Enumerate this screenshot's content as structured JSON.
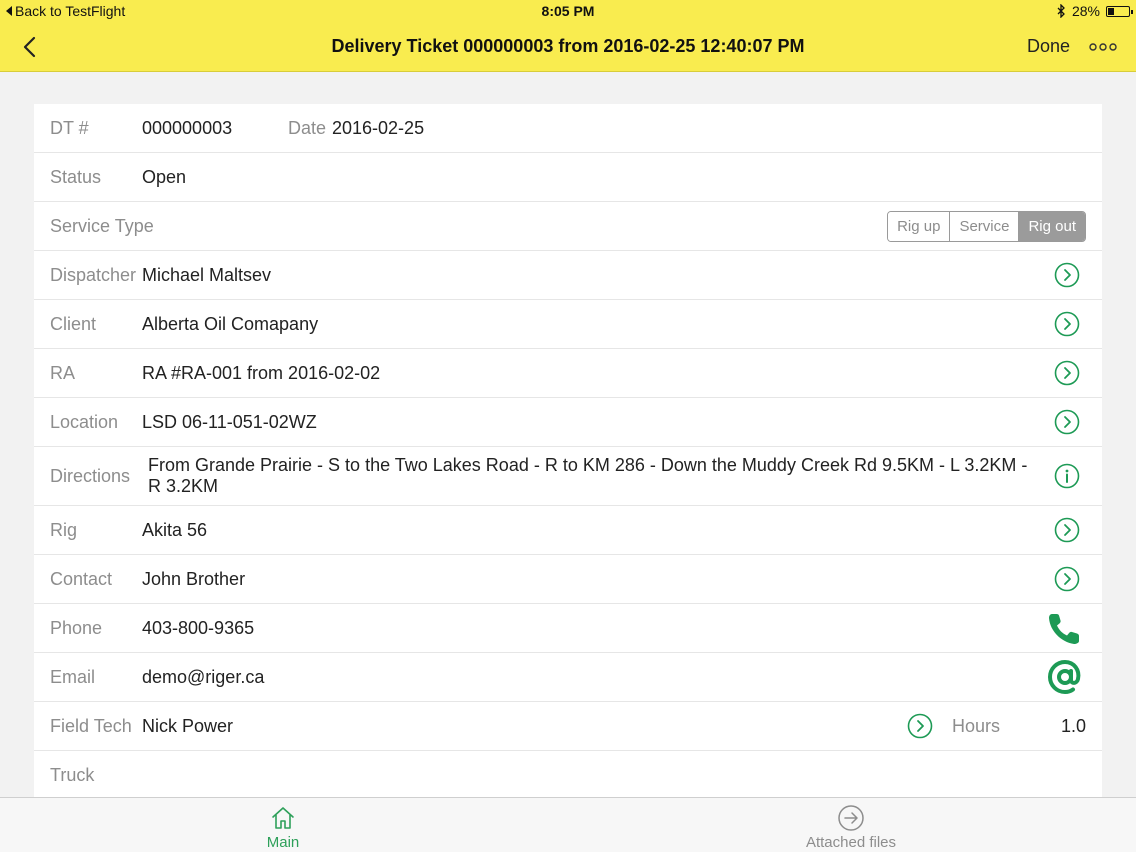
{
  "status_bar": {
    "back_label": "Back to TestFlight",
    "time": "8:05 PM",
    "battery": "28%",
    "battery_level": 0.28
  },
  "nav": {
    "title": "Delivery Ticket 000000003 from 2016-02-25 12:40:07 PM",
    "done_label": "Done"
  },
  "form": {
    "dt": {
      "label": "DT #",
      "value": "000000003",
      "date_label": "Date",
      "date_value": "2016-02-25"
    },
    "status": {
      "label": "Status",
      "value": "Open"
    },
    "service_type": {
      "label": "Service Type",
      "options": [
        "Rig up",
        "Service",
        "Rig out"
      ],
      "selected": "Rig out"
    },
    "dispatcher": {
      "label": "Dispatcher",
      "value": "Michael Maltsev"
    },
    "client": {
      "label": "Client",
      "value": "Alberta Oil Comapany"
    },
    "ra": {
      "label": "RA",
      "value": "RA #RA-001 from 2016-02-02"
    },
    "location": {
      "label": "Location",
      "value": "LSD 06-11-051-02WZ"
    },
    "directions": {
      "label": "Directions",
      "value": "From Grande Prairie - S to the Two Lakes Road - R to KM 286 - Down the Muddy Creek Rd 9.5KM - L 3.2KM - R 3.2KM"
    },
    "rig": {
      "label": "Rig",
      "value": "Akita 56"
    },
    "contact": {
      "label": "Contact",
      "value": "John Brother"
    },
    "phone": {
      "label": "Phone",
      "value": "403-800-9365"
    },
    "email": {
      "label": "Email",
      "value": "demo@riger.ca"
    },
    "field_tech": {
      "label": "Field Tech",
      "value": "Nick Power",
      "hours_label": "Hours",
      "hours_value": "1.0"
    },
    "truck": {
      "label": "Truck",
      "value": ""
    }
  },
  "tabs": [
    {
      "label": "Main",
      "icon": "home-icon",
      "active": true
    },
    {
      "label": "Attached files",
      "icon": "arrow-circle-icon",
      "active": false
    }
  ],
  "colors": {
    "header_bg": "#f9ec4f",
    "accent_green": "#2ea05a",
    "icon_green": "#1d9a55"
  }
}
